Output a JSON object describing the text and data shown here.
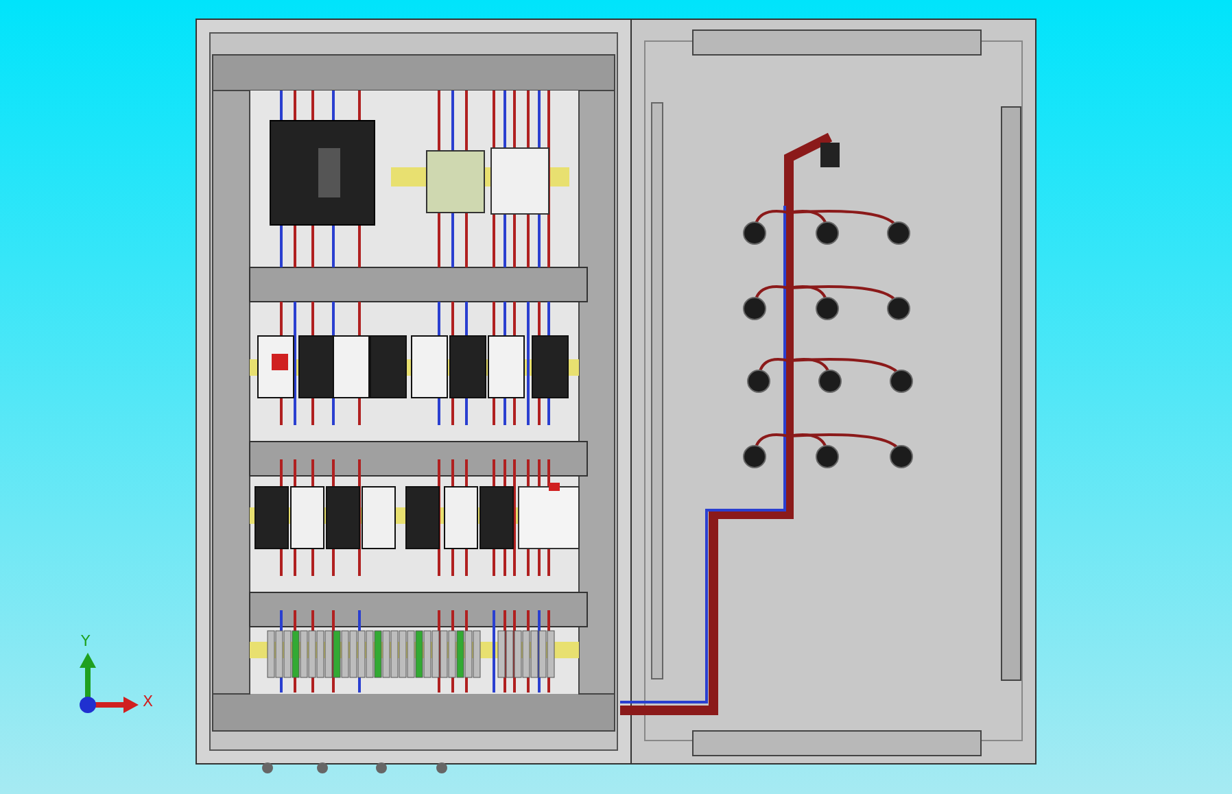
{
  "viewport": {
    "triad": {
      "y_label": "Y",
      "x_label": "X"
    }
  }
}
